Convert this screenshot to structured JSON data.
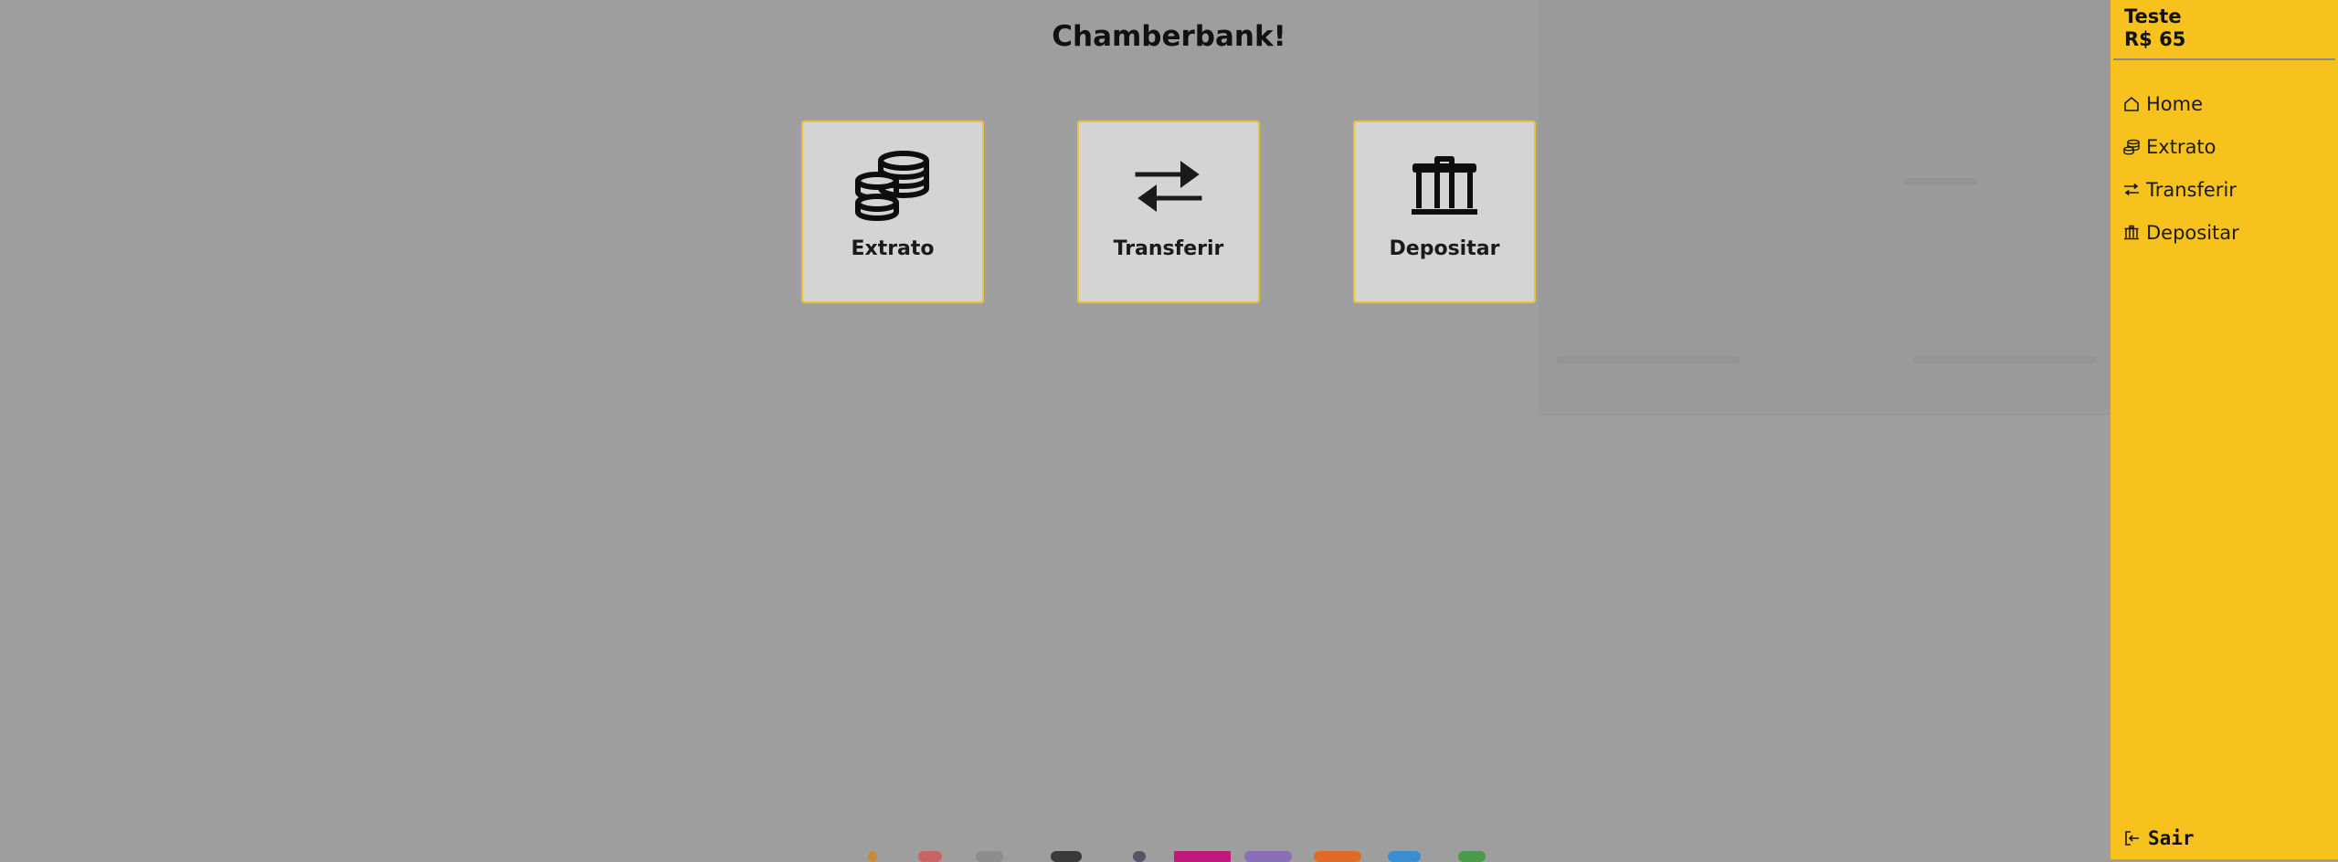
{
  "app": {
    "title": "Chamberbank!"
  },
  "cards": [
    {
      "label": "Extrato",
      "icon": "coins-icon"
    },
    {
      "label": "Transferir",
      "icon": "arrows-exchange-icon"
    },
    {
      "label": "Depositar",
      "icon": "bank-icon"
    }
  ],
  "sidebar": {
    "user_name": "Teste",
    "balance": "R$ 65",
    "items": [
      {
        "label": "Home",
        "icon": "home-icon"
      },
      {
        "label": "Extrato",
        "icon": "coins-icon"
      },
      {
        "label": "Transferir",
        "icon": "arrows-exchange-icon"
      },
      {
        "label": "Depositar",
        "icon": "bank-icon"
      }
    ],
    "logout_label": "Sair"
  },
  "colors": {
    "accent": "#f7c21e",
    "background": "#9e9e9e",
    "card": "#d4d4d4",
    "card_border": "#e8c23a"
  }
}
